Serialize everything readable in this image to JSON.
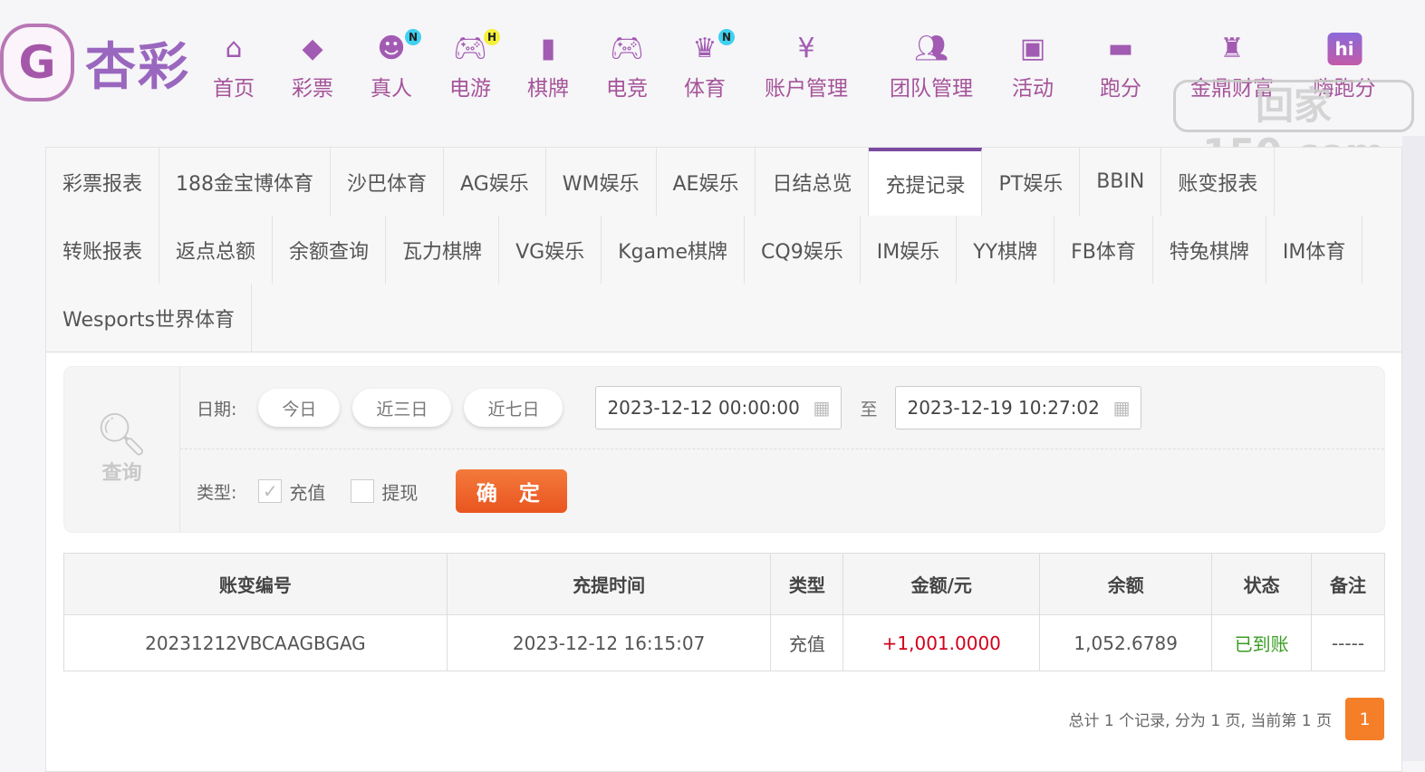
{
  "logo": {
    "mark": "G",
    "text": "杏彩"
  },
  "nav": [
    {
      "label": "首页",
      "icon": "home-icon",
      "glyph": "⌂"
    },
    {
      "label": "彩票",
      "icon": "ticket-icon",
      "glyph": "◆"
    },
    {
      "label": "真人",
      "icon": "live-dealer-icon",
      "glyph": "☻",
      "badge": "N",
      "badge_color": "#3fd0f0"
    },
    {
      "label": "电游",
      "icon": "gamepad-icon",
      "glyph": "🎮︎",
      "badge": "H",
      "badge_color": "#f5f03a"
    },
    {
      "label": "棋牌",
      "icon": "cards-icon",
      "glyph": "▮"
    },
    {
      "label": "电竞",
      "icon": "esports-icon",
      "glyph": "🎮︎"
    },
    {
      "label": "体育",
      "icon": "trophy-icon",
      "glyph": "♛",
      "badge": "N",
      "badge_color": "#3fd0f0"
    },
    {
      "label": "账户管理",
      "icon": "yen-coin-icon",
      "glyph": "¥"
    },
    {
      "label": "团队管理",
      "icon": "team-icon",
      "glyph": "👥︎"
    },
    {
      "label": "活动",
      "icon": "gift-icon",
      "glyph": "▣"
    },
    {
      "label": "跑分",
      "icon": "rhino-icon",
      "glyph": "▬"
    },
    {
      "label": "金鼎财富",
      "icon": "tripod-icon",
      "glyph": "♜"
    },
    {
      "label": "嗨跑分",
      "icon": "hi-app-icon",
      "glyph": "hi"
    }
  ],
  "watermark": "回家150.com",
  "tabs": [
    "彩票报表",
    "188金宝博体育",
    "沙巴体育",
    "AG娱乐",
    "WM娱乐",
    "AE娱乐",
    "日结总览",
    "充提记录",
    "PT娱乐",
    "BBIN",
    "账变报表",
    "转账报表",
    "返点总额",
    "余额查询",
    "瓦力棋牌",
    "VG娱乐",
    "Kgame棋牌",
    "CQ9娱乐",
    "IM娱乐",
    "YY棋牌",
    "FB体育",
    "特兔棋牌",
    "IM体育",
    "Wesports世界体育"
  ],
  "active_tab": "充提记录",
  "query": {
    "label": "查询",
    "date_label": "日期:",
    "quick": [
      "今日",
      "近三日",
      "近七日"
    ],
    "start": "2023-12-12 00:00:00",
    "to": "至",
    "end": "2023-12-19 10:27:02",
    "type_label": "类型:",
    "types": [
      {
        "label": "充值",
        "checked": true
      },
      {
        "label": "提现",
        "checked": false
      }
    ],
    "confirm": "确 定"
  },
  "table": {
    "headers": [
      "账变编号",
      "充提时间",
      "类型",
      "金额/元",
      "余额",
      "状态",
      "备注"
    ],
    "rows": [
      [
        "20231212VBCAAGBGAG",
        "2023-12-12 16:15:07",
        "充值",
        "+1,001.0000",
        "1,052.6789",
        "已到账",
        "-----"
      ]
    ]
  },
  "colors": {
    "amount": "#d0021b",
    "status": "#3a9d23",
    "accent": "#7a4ba0",
    "confirm": "#ec5f27",
    "page": "#f57e28"
  },
  "pagination": {
    "summary": "总计 1 个记录, 分为 1 页, 当前第 1 页",
    "current": "1"
  }
}
